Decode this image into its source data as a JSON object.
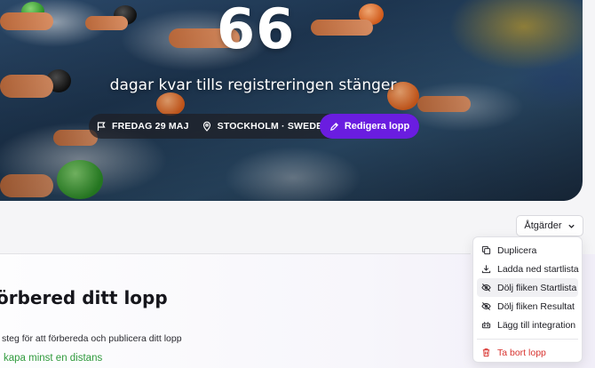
{
  "hero": {
    "days_count": "66",
    "subtitle": "dagar kvar tills registreringen stänger",
    "date": "FREDAG 29 MAJ",
    "location": "STOCKHOLM · SWEDEN",
    "edit_label": "Redigera lopp"
  },
  "toolbar": {
    "actions_label": "Åtgärder"
  },
  "menu": {
    "items": [
      {
        "label": "Duplicera",
        "icon": "copy-icon"
      },
      {
        "label": "Ladda ned startlista",
        "icon": "download-icon"
      },
      {
        "label": "Dölj fliken Startlista",
        "icon": "eye-off-icon"
      },
      {
        "label": "Dölj fliken Resultat",
        "icon": "eye-off-icon"
      },
      {
        "label": "Lägg till integration",
        "icon": "plug-icon"
      }
    ],
    "delete_label": "Ta bort lopp"
  },
  "page": {
    "heading": "örbered ditt lopp",
    "description": "steg för att förbereda och publicera ditt lopp",
    "link": "kapa minst en distans"
  },
  "colors": {
    "accent": "#6a1de0",
    "link": "#2f9a3c",
    "danger": "#d8332f"
  }
}
